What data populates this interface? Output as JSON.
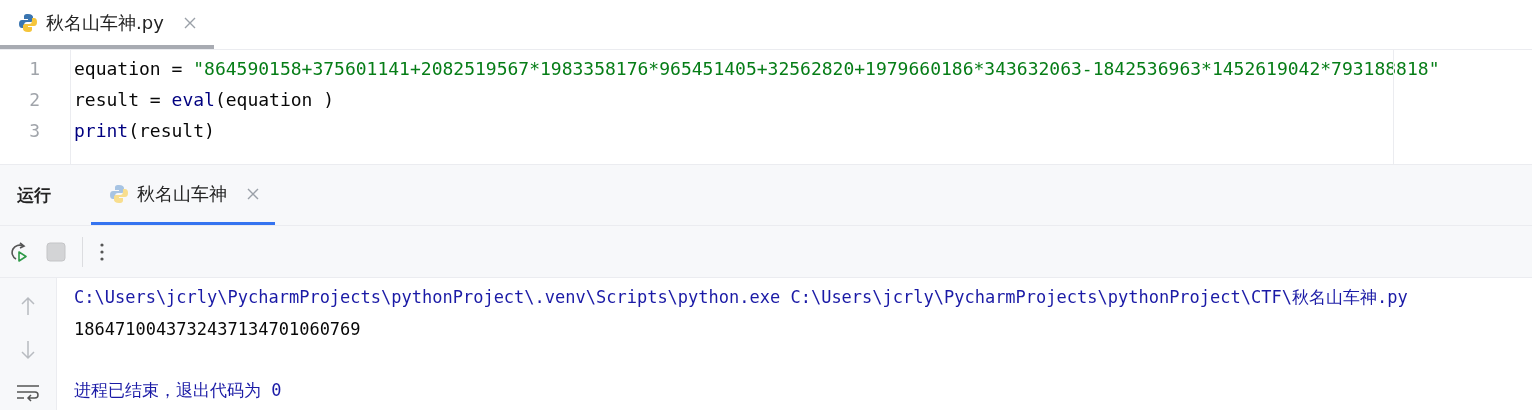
{
  "editor_tabs": [
    {
      "label": "秋名山车神.py",
      "selected": true
    }
  ],
  "code_lines": [
    {
      "number": "1",
      "tokens": [
        {
          "kind": "plain",
          "text": "equation = "
        },
        {
          "kind": "string",
          "text": "\"864590158+375601141+2082519567*1983358176*965451405+32562820+1979660186*343632063-1842536963*1452619042*793188818\""
        }
      ]
    },
    {
      "number": "2",
      "tokens": [
        {
          "kind": "plain",
          "text": "result = "
        },
        {
          "kind": "builtin",
          "text": "eval"
        },
        {
          "kind": "plain",
          "text": "(equation )"
        }
      ]
    },
    {
      "number": "3",
      "tokens": [
        {
          "kind": "builtin",
          "text": "print"
        },
        {
          "kind": "plain",
          "text": "(result)"
        }
      ]
    }
  ],
  "run_panel": {
    "title": "运行",
    "tabs": [
      {
        "label": "秋名山车神",
        "selected": true
      }
    ]
  },
  "console_lines": [
    {
      "kind": "command",
      "text": "C:\\Users\\jcrly\\PycharmProjects\\pythonProject\\.venv\\Scripts\\python.exe C:\\Users\\jcrly\\PycharmProjects\\pythonProject\\CTF\\秋名山车神.py"
    },
    {
      "kind": "output",
      "text": "1864710043732437134701060769"
    },
    {
      "kind": "system",
      "text": "进程已结束，退出代码为 0"
    }
  ]
}
